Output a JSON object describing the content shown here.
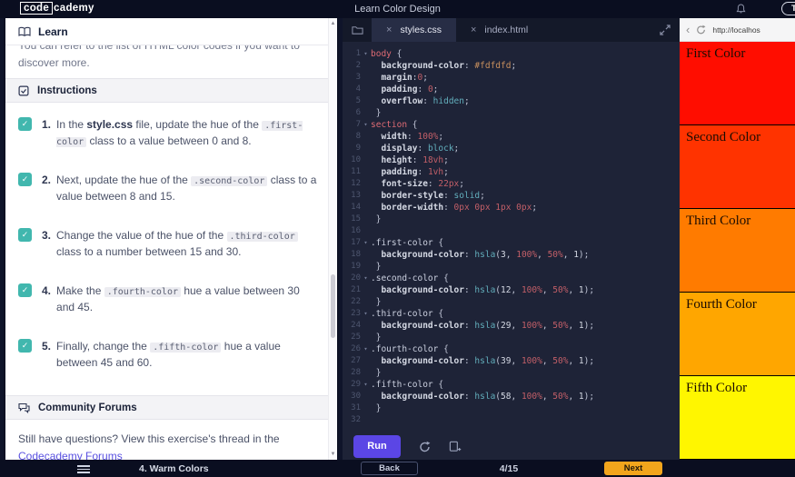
{
  "header": {
    "logo_code": "code",
    "logo_rest": "cademy",
    "title": "Learn Color Design",
    "upgrade_label": "Tr"
  },
  "learn_panel": {
    "learn_label": "Learn",
    "clipped_line": "You can refer to the list of HTML color codes if you want to",
    "visible_line": "discover more.",
    "instructions_label": "Instructions",
    "checklist": [
      {
        "number": "1.",
        "segments": [
          [
            "t",
            "In the "
          ],
          [
            "b",
            "style.css"
          ],
          [
            "t",
            " file, update the hue of the "
          ],
          [
            "c",
            ".first-color"
          ],
          [
            "t",
            " class to a value between 0 and 8."
          ]
        ]
      },
      {
        "number": "2.",
        "segments": [
          [
            "t",
            "Next, update the hue of the "
          ],
          [
            "c",
            ".second-color"
          ],
          [
            "t",
            " class to a value between 8 and 15."
          ]
        ]
      },
      {
        "number": "3.",
        "segments": [
          [
            "t",
            "Change the value of the hue of the "
          ],
          [
            "c",
            ".third-color"
          ],
          [
            "t",
            " class to a number between 15 and 30."
          ]
        ]
      },
      {
        "number": "4.",
        "segments": [
          [
            "t",
            "Make the "
          ],
          [
            "c",
            ".fourth-color"
          ],
          [
            "t",
            " hue a value between 30 and 45."
          ]
        ]
      },
      {
        "number": "5.",
        "segments": [
          [
            "t",
            "Finally, change the "
          ],
          [
            "c",
            ".fifth-color"
          ],
          [
            "t",
            " hue a value between 45 and 60."
          ]
        ]
      }
    ],
    "community_label": "Community Forums",
    "forum_text": "Still have questions? View this exercise's thread in the ",
    "forum_link": "Codecademy Forums"
  },
  "editor": {
    "tabs": [
      {
        "label": "styles.css",
        "active": true
      },
      {
        "label": "index.html",
        "active": false
      }
    ],
    "run_label": "Run",
    "lines": [
      {
        "n": 1,
        "f": 1,
        "t": [
          [
            "sel",
            "body"
          ],
          [
            "pun",
            " {"
          ]
        ]
      },
      {
        "n": 2,
        "t": [
          [
            "prop",
            "  background-color"
          ],
          [
            "pun",
            ": "
          ],
          [
            "hex",
            "#fdfdfd"
          ],
          [
            "pun",
            ";"
          ]
        ]
      },
      {
        "n": 3,
        "t": [
          [
            "prop",
            "  margin"
          ],
          [
            "pun",
            ":"
          ],
          [
            "val",
            "0"
          ],
          [
            "pun",
            ";"
          ]
        ]
      },
      {
        "n": 4,
        "t": [
          [
            "prop",
            "  padding"
          ],
          [
            "pun",
            ": "
          ],
          [
            "val",
            "0"
          ],
          [
            "pun",
            ";"
          ]
        ]
      },
      {
        "n": 5,
        "t": [
          [
            "prop",
            "  overflow"
          ],
          [
            "pun",
            ": "
          ],
          [
            "kw",
            "hidden"
          ],
          [
            "pun",
            ";"
          ]
        ]
      },
      {
        "n": 6,
        "t": [
          [
            "pun",
            " }"
          ]
        ]
      },
      {
        "n": 7,
        "f": 1,
        "t": [
          [
            "sel",
            "section"
          ],
          [
            "pun",
            " {"
          ]
        ]
      },
      {
        "n": 8,
        "t": [
          [
            "prop",
            "  width"
          ],
          [
            "pun",
            ": "
          ],
          [
            "val",
            "100%"
          ],
          [
            "pun",
            ";"
          ]
        ]
      },
      {
        "n": 9,
        "t": [
          [
            "prop",
            "  display"
          ],
          [
            "pun",
            ": "
          ],
          [
            "kw",
            "block"
          ],
          [
            "pun",
            ";"
          ]
        ]
      },
      {
        "n": 10,
        "t": [
          [
            "prop",
            "  height"
          ],
          [
            "pun",
            ": "
          ],
          [
            "val",
            "18vh"
          ],
          [
            "pun",
            ";"
          ]
        ]
      },
      {
        "n": 11,
        "t": [
          [
            "prop",
            "  padding"
          ],
          [
            "pun",
            ": "
          ],
          [
            "val",
            "1vh"
          ],
          [
            "pun",
            ";"
          ]
        ]
      },
      {
        "n": 12,
        "t": [
          [
            "prop",
            "  font-size"
          ],
          [
            "pun",
            ": "
          ],
          [
            "val",
            "22px"
          ],
          [
            "pun",
            ";"
          ]
        ]
      },
      {
        "n": 13,
        "t": [
          [
            "prop",
            "  border-style"
          ],
          [
            "pun",
            ": "
          ],
          [
            "kw",
            "solid"
          ],
          [
            "pun",
            ";"
          ]
        ]
      },
      {
        "n": 14,
        "t": [
          [
            "prop",
            "  border-width"
          ],
          [
            "pun",
            ": "
          ],
          [
            "val",
            "0px 0px 1px 0px"
          ],
          [
            "pun",
            ";"
          ]
        ]
      },
      {
        "n": 15,
        "t": [
          [
            "pun",
            " }"
          ]
        ]
      },
      {
        "n": 16,
        "t": []
      },
      {
        "n": 17,
        "f": 1,
        "t": [
          [
            "cls",
            ".first-color"
          ],
          [
            "pun",
            " {"
          ]
        ]
      },
      {
        "n": 18,
        "t": [
          [
            "prop",
            "  background-color"
          ],
          [
            "pun",
            ": "
          ],
          [
            "fn",
            "hsla"
          ],
          [
            "pun",
            "("
          ],
          [
            "num",
            "3"
          ],
          [
            "pun",
            ", "
          ],
          [
            "val",
            "100%"
          ],
          [
            "pun",
            ", "
          ],
          [
            "val",
            "50%"
          ],
          [
            "pun",
            ", "
          ],
          [
            "num",
            "1"
          ],
          [
            "pun",
            ");"
          ]
        ]
      },
      {
        "n": 19,
        "t": [
          [
            "pun",
            " }"
          ]
        ]
      },
      {
        "n": 20,
        "f": 1,
        "t": [
          [
            "cls",
            ".second-color"
          ],
          [
            "pun",
            " {"
          ]
        ]
      },
      {
        "n": 21,
        "t": [
          [
            "prop",
            "  background-color"
          ],
          [
            "pun",
            ": "
          ],
          [
            "fn",
            "hsla"
          ],
          [
            "pun",
            "("
          ],
          [
            "num",
            "12"
          ],
          [
            "pun",
            ", "
          ],
          [
            "val",
            "100%"
          ],
          [
            "pun",
            ", "
          ],
          [
            "val",
            "50%"
          ],
          [
            "pun",
            ", "
          ],
          [
            "num",
            "1"
          ],
          [
            "pun",
            ");"
          ]
        ]
      },
      {
        "n": 22,
        "t": [
          [
            "pun",
            " }"
          ]
        ]
      },
      {
        "n": 23,
        "f": 1,
        "t": [
          [
            "cls",
            ".third-color"
          ],
          [
            "pun",
            " {"
          ]
        ]
      },
      {
        "n": 24,
        "t": [
          [
            "prop",
            "  background-color"
          ],
          [
            "pun",
            ": "
          ],
          [
            "fn",
            "hsla"
          ],
          [
            "pun",
            "("
          ],
          [
            "num",
            "29"
          ],
          [
            "pun",
            ", "
          ],
          [
            "val",
            "100%"
          ],
          [
            "pun",
            ", "
          ],
          [
            "val",
            "50%"
          ],
          [
            "pun",
            ", "
          ],
          [
            "num",
            "1"
          ],
          [
            "pun",
            ");"
          ]
        ]
      },
      {
        "n": 25,
        "t": [
          [
            "pun",
            " }"
          ]
        ]
      },
      {
        "n": 26,
        "f": 1,
        "t": [
          [
            "cls",
            ".fourth-color"
          ],
          [
            "pun",
            " {"
          ]
        ]
      },
      {
        "n": 27,
        "t": [
          [
            "prop",
            "  background-color"
          ],
          [
            "pun",
            ": "
          ],
          [
            "fn",
            "hsla"
          ],
          [
            "pun",
            "("
          ],
          [
            "num",
            "39"
          ],
          [
            "pun",
            ", "
          ],
          [
            "val",
            "100%"
          ],
          [
            "pun",
            ", "
          ],
          [
            "val",
            "50%"
          ],
          [
            "pun",
            ", "
          ],
          [
            "num",
            "1"
          ],
          [
            "pun",
            ");"
          ]
        ]
      },
      {
        "n": 28,
        "t": [
          [
            "pun",
            " }"
          ]
        ]
      },
      {
        "n": 29,
        "f": 1,
        "t": [
          [
            "cls",
            ".fifth-color"
          ],
          [
            "pun",
            " {"
          ]
        ]
      },
      {
        "n": 30,
        "t": [
          [
            "prop",
            "  background-color"
          ],
          [
            "pun",
            ": "
          ],
          [
            "fn",
            "hsla"
          ],
          [
            "pun",
            "("
          ],
          [
            "num",
            "58"
          ],
          [
            "pun",
            ", "
          ],
          [
            "val",
            "100%"
          ],
          [
            "pun",
            ", "
          ],
          [
            "val",
            "50%"
          ],
          [
            "pun",
            ", "
          ],
          [
            "num",
            "1"
          ],
          [
            "pun",
            ");"
          ]
        ]
      },
      {
        "n": 31,
        "t": [
          [
            "pun",
            " }"
          ]
        ]
      },
      {
        "n": 32,
        "t": []
      }
    ]
  },
  "preview": {
    "url": "http://localhos",
    "sections": [
      {
        "label": "First Color",
        "color": "#FF0D00"
      },
      {
        "label": "Second Color",
        "color": "#FF3300"
      },
      {
        "label": "Third Color",
        "color": "#FF7B00"
      },
      {
        "label": "Fourth Color",
        "color": "#FFA600"
      },
      {
        "label": "Fifth Color",
        "color": "#FFF600"
      }
    ]
  },
  "footer": {
    "lesson_label": "4. Warm Colors",
    "back_label": "Back",
    "progress": "4/15",
    "next_label": "Next"
  },
  "icons": {
    "close": "×",
    "back": "‹",
    "fold": "▾",
    "scroll_up": "▲",
    "scroll_down": "▼",
    "check": "✓"
  },
  "colors": {
    "run_button": "#5b46e5",
    "next_button": "#f2a51c",
    "check_teal": "#41b7ae",
    "link": "#5a51e1"
  }
}
